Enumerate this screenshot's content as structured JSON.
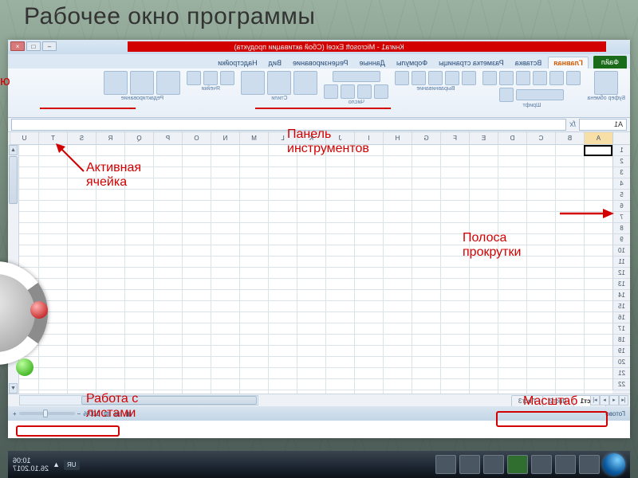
{
  "slide": {
    "title": "Рабочее окно программы"
  },
  "annotations": {
    "menu": "ю",
    "toolbar": "Панель\nинструментов",
    "active_cell": "Активная\nячейка",
    "scrollbar": "Полоса\nпрокрутки",
    "sheets": "Работа с\nлистами",
    "zoom": "Масштаб"
  },
  "titlebar": {
    "text": "Книга1 - Microsoft Excel (Сбой активации продукта)"
  },
  "ribbon": {
    "file": "Файл",
    "tabs": [
      "Главная",
      "Вставка",
      "Разметка страницы",
      "Формулы",
      "Данные",
      "Рецензирование",
      "Вид",
      "Надстройки"
    ],
    "groups": [
      "Буфер обмена",
      "Шрифт",
      "Выравнивание",
      "Число",
      "Стили",
      "Ячейки",
      "Редактирование"
    ]
  },
  "namebox": "A1",
  "columns": [
    "A",
    "B",
    "C",
    "D",
    "E",
    "F",
    "G",
    "H",
    "I",
    "J",
    "K",
    "L",
    "M",
    "N",
    "O",
    "P",
    "Q",
    "R",
    "S",
    "T",
    "U"
  ],
  "rows": [
    "1",
    "2",
    "3",
    "4",
    "5",
    "6",
    "7",
    "8",
    "9",
    "10",
    "11",
    "12",
    "13",
    "14",
    "15",
    "16",
    "17",
    "18",
    "19",
    "20",
    "21",
    "22"
  ],
  "sheets": {
    "items": [
      "Лист1",
      "Лист2",
      "Лист3"
    ]
  },
  "status": {
    "ready": "Готово",
    "zoom": "100%"
  },
  "taskbar": {
    "lang": "UR",
    "time": "10:06",
    "date": "26.10.2017"
  }
}
